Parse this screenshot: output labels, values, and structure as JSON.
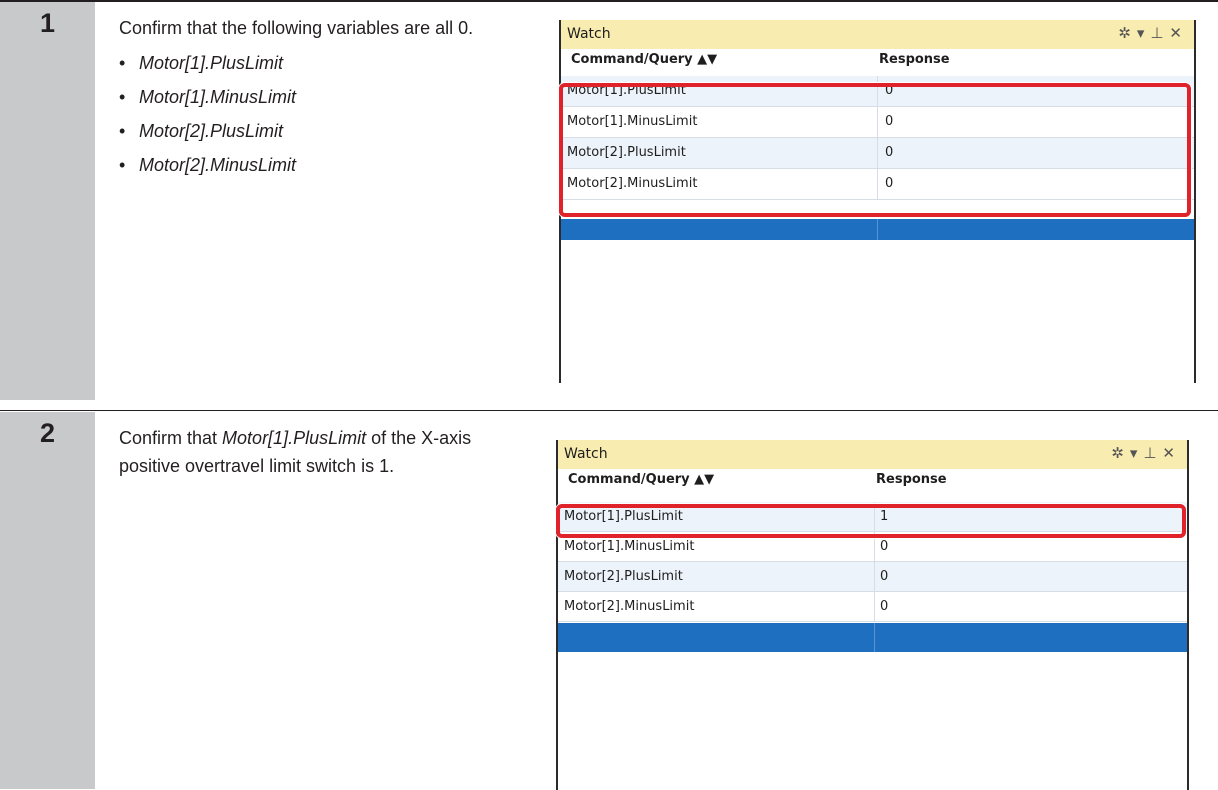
{
  "steps": [
    {
      "number": "1",
      "text": "Confirm that the following variables are all 0.",
      "bullets": [
        "Motor[1].PlusLimit",
        "Motor[1].MinusLimit",
        "Motor[2].PlusLimit",
        "Motor[2].MinusLimit"
      ],
      "watch": {
        "title": "Watch",
        "headers": {
          "command": "Command/Query ▲▼",
          "response": "Response"
        },
        "rows": [
          {
            "command": "Motor[1].PlusLimit",
            "response": "0"
          },
          {
            "command": "Motor[1].MinusLimit",
            "response": "0"
          },
          {
            "command": "Motor[2].PlusLimit",
            "response": "0"
          },
          {
            "command": "Motor[2].MinusLimit",
            "response": "0"
          }
        ]
      }
    },
    {
      "number": "2",
      "text_before": "Confirm that ",
      "text_italic": "Motor[1].PlusLimit",
      "text_after": " of the X-axis positive overtravel limit switch is 1.",
      "watch": {
        "title": "Watch",
        "headers": {
          "command": "Command/Query ▲▼",
          "response": "Response"
        },
        "rows": [
          {
            "command": "Motor[1].PlusLimit",
            "response": "1"
          },
          {
            "command": "Motor[1].MinusLimit",
            "response": "0"
          },
          {
            "command": "Motor[2].PlusLimit",
            "response": "0"
          },
          {
            "command": "Motor[2].MinusLimit",
            "response": "0"
          }
        ]
      }
    }
  ],
  "icons": {
    "settings": "gear-icon",
    "dropdown": "dropdown-arrow-icon",
    "pin": "pin-icon",
    "close": "close-icon"
  },
  "colors": {
    "title_bar": "#f8ecb0",
    "highlight": "#e0222a",
    "selected_row": "#1e6fc0",
    "number_column": "#c8c9ca"
  }
}
